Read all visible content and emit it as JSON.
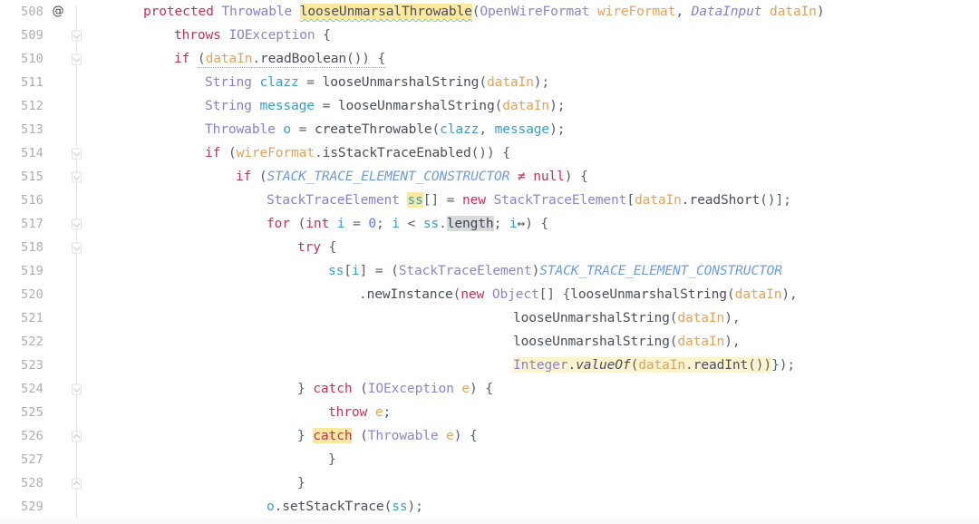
{
  "editor": {
    "language": "Java",
    "first_line": 508,
    "last_line": 529,
    "colors": {
      "background": "#ffffff",
      "line_number": "#adadad",
      "keyword": "#c0355b",
      "type": "#8a7fd0",
      "local_variable": "#3aa0c4",
      "parameter": "#e0a45e",
      "static_field": "#6f9ddb",
      "number": "#5a7fd0",
      "punctuation": "#56606e",
      "highlight_yellow": "#fbe9a0",
      "highlight_pale_yellow": "#fcf3cf",
      "highlight_gray": "#d8dadd",
      "typo_underline": "#7ec27e"
    },
    "gutter": {
      "annotation_marker": "@",
      "annotation_line": 508,
      "fold_open_lines": [
        509,
        510,
        514,
        515,
        517,
        518,
        524
      ],
      "fold_close_lines": [
        526,
        528
      ]
    },
    "lines": [
      {
        "number": "508",
        "indent": 1,
        "gutter_icon": "@",
        "fold": "none",
        "tokens": [
          {
            "text": "protected",
            "cls": "t-kw"
          },
          {
            "text": " ",
            "cls": "t-punc"
          },
          {
            "text": "Throwable",
            "cls": "t-type"
          },
          {
            "text": " ",
            "cls": "t-punc"
          },
          {
            "text": "looseUnmarsalThrowable",
            "cls": "t-method",
            "hl": "hl-yellow",
            "underline": "u-typo"
          },
          {
            "text": "(",
            "cls": "t-punc"
          },
          {
            "text": "OpenWireFormat",
            "cls": "t-cls"
          },
          {
            "text": " ",
            "cls": "t-punc"
          },
          {
            "text": "wireFormat",
            "cls": "t-param"
          },
          {
            "text": ", ",
            "cls": "t-punc"
          },
          {
            "text": "DataInput",
            "cls": "t-italic"
          },
          {
            "text": " ",
            "cls": "t-punc"
          },
          {
            "text": "dataIn",
            "cls": "t-param"
          },
          {
            "text": ")",
            "cls": "t-punc"
          }
        ]
      },
      {
        "number": "509",
        "indent": 2,
        "gutter_icon": "",
        "fold": "open",
        "tokens": [
          {
            "text": "throws",
            "cls": "t-kw"
          },
          {
            "text": " ",
            "cls": "t-punc"
          },
          {
            "text": "IOException",
            "cls": "t-cls"
          },
          {
            "text": " {",
            "cls": "t-punc"
          }
        ]
      },
      {
        "number": "510",
        "indent": 2,
        "gutter_icon": "",
        "fold": "open",
        "tokens": [
          {
            "text": "if",
            "cls": "t-kw"
          },
          {
            "text": " ",
            "cls": "t-punc"
          },
          {
            "text": "(",
            "cls": "t-punc",
            "underline": "u-dotted"
          },
          {
            "text": "dataIn",
            "cls": "t-param",
            "underline": "u-dotted"
          },
          {
            "text": ".",
            "cls": "t-punc",
            "underline": "u-dotted"
          },
          {
            "text": "readBoolean",
            "cls": "t-method",
            "underline": "u-dotted"
          },
          {
            "text": "()) {",
            "cls": "t-punc",
            "underline": "u-dotted"
          }
        ]
      },
      {
        "number": "511",
        "indent": 3,
        "gutter_icon": "",
        "fold": "none",
        "tokens": [
          {
            "text": "String",
            "cls": "t-type"
          },
          {
            "text": " ",
            "cls": "t-punc"
          },
          {
            "text": "clazz",
            "cls": "t-local"
          },
          {
            "text": " = ",
            "cls": "t-op"
          },
          {
            "text": "looseUnmarshalString",
            "cls": "t-method"
          },
          {
            "text": "(",
            "cls": "t-punc"
          },
          {
            "text": "dataIn",
            "cls": "t-param"
          },
          {
            "text": ");",
            "cls": "t-punc"
          }
        ]
      },
      {
        "number": "512",
        "indent": 3,
        "gutter_icon": "",
        "fold": "none",
        "tokens": [
          {
            "text": "String",
            "cls": "t-type"
          },
          {
            "text": " ",
            "cls": "t-punc"
          },
          {
            "text": "message",
            "cls": "t-local"
          },
          {
            "text": " = ",
            "cls": "t-op"
          },
          {
            "text": "looseUnmarshalString",
            "cls": "t-method"
          },
          {
            "text": "(",
            "cls": "t-punc"
          },
          {
            "text": "dataIn",
            "cls": "t-param"
          },
          {
            "text": ");",
            "cls": "t-punc"
          }
        ]
      },
      {
        "number": "513",
        "indent": 3,
        "gutter_icon": "",
        "fold": "none",
        "tokens": [
          {
            "text": "Throwable",
            "cls": "t-type"
          },
          {
            "text": " ",
            "cls": "t-punc"
          },
          {
            "text": "o",
            "cls": "t-local"
          },
          {
            "text": " = ",
            "cls": "t-op"
          },
          {
            "text": "createThrowable",
            "cls": "t-method"
          },
          {
            "text": "(",
            "cls": "t-punc"
          },
          {
            "text": "clazz",
            "cls": "t-local"
          },
          {
            "text": ", ",
            "cls": "t-punc"
          },
          {
            "text": "message",
            "cls": "t-local"
          },
          {
            "text": ");",
            "cls": "t-punc"
          }
        ]
      },
      {
        "number": "514",
        "indent": 3,
        "gutter_icon": "",
        "fold": "open",
        "tokens": [
          {
            "text": "if",
            "cls": "t-kw"
          },
          {
            "text": " (",
            "cls": "t-punc"
          },
          {
            "text": "wireFormat",
            "cls": "t-param"
          },
          {
            "text": ".",
            "cls": "t-punc"
          },
          {
            "text": "isStackTraceEnabled",
            "cls": "t-method"
          },
          {
            "text": "()) {",
            "cls": "t-punc"
          }
        ]
      },
      {
        "number": "515",
        "indent": 4,
        "gutter_icon": "",
        "fold": "open",
        "tokens": [
          {
            "text": "if",
            "cls": "t-kw"
          },
          {
            "text": " (",
            "cls": "t-punc"
          },
          {
            "text": "STACK_TRACE_ELEMENT_CONSTRUCTOR",
            "cls": "t-static"
          },
          {
            "text": " ",
            "cls": "t-punc"
          },
          {
            "text": "≠",
            "cls": "t-kw"
          },
          {
            "text": " ",
            "cls": "t-punc"
          },
          {
            "text": "null",
            "cls": "t-kw"
          },
          {
            "text": ") {",
            "cls": "t-punc"
          }
        ]
      },
      {
        "number": "516",
        "indent": 5,
        "gutter_icon": "",
        "fold": "none",
        "tokens": [
          {
            "text": "StackTraceElement",
            "cls": "t-type"
          },
          {
            "text": " ",
            "cls": "t-punc"
          },
          {
            "text": "ss",
            "cls": "t-local",
            "hl": "hl-yellow"
          },
          {
            "text": "[] = ",
            "cls": "t-punc"
          },
          {
            "text": "new",
            "cls": "t-kw"
          },
          {
            "text": " ",
            "cls": "t-punc"
          },
          {
            "text": "StackTraceElement",
            "cls": "t-cls"
          },
          {
            "text": "[",
            "cls": "t-punc"
          },
          {
            "text": "dataIn",
            "cls": "t-param"
          },
          {
            "text": ".",
            "cls": "t-punc"
          },
          {
            "text": "readShort",
            "cls": "t-method"
          },
          {
            "text": "()];",
            "cls": "t-punc"
          }
        ]
      },
      {
        "number": "517",
        "indent": 5,
        "gutter_icon": "",
        "fold": "open",
        "tokens": [
          {
            "text": "for",
            "cls": "t-kw"
          },
          {
            "text": " (",
            "cls": "t-punc"
          },
          {
            "text": "int",
            "cls": "t-kw"
          },
          {
            "text": " ",
            "cls": "t-punc"
          },
          {
            "text": "i",
            "cls": "t-local"
          },
          {
            "text": " = ",
            "cls": "t-op"
          },
          {
            "text": "0",
            "cls": "t-num"
          },
          {
            "text": "; ",
            "cls": "t-punc"
          },
          {
            "text": "i",
            "cls": "t-local"
          },
          {
            "text": " < ",
            "cls": "t-op"
          },
          {
            "text": "ss",
            "cls": "t-local"
          },
          {
            "text": ".",
            "cls": "t-punc"
          },
          {
            "text": "length",
            "cls": "t-field",
            "hl": "hl-gray"
          },
          {
            "text": "; ",
            "cls": "t-punc"
          },
          {
            "text": "i",
            "cls": "t-local"
          },
          {
            "text": "↔",
            "cls": "t-op"
          },
          {
            "text": ") {",
            "cls": "t-punc"
          }
        ]
      },
      {
        "number": "518",
        "indent": 6,
        "gutter_icon": "",
        "fold": "open",
        "tokens": [
          {
            "text": "try",
            "cls": "t-kw"
          },
          {
            "text": " {",
            "cls": "t-punc"
          }
        ]
      },
      {
        "number": "519",
        "indent": 7,
        "gutter_icon": "",
        "fold": "none",
        "tokens": [
          {
            "text": "ss",
            "cls": "t-local"
          },
          {
            "text": "[",
            "cls": "t-punc"
          },
          {
            "text": "i",
            "cls": "t-local"
          },
          {
            "text": "] = (",
            "cls": "t-punc"
          },
          {
            "text": "StackTraceElement",
            "cls": "t-cls"
          },
          {
            "text": ")",
            "cls": "t-punc"
          },
          {
            "text": "STACK_TRACE_ELEMENT_CONSTRUCTOR",
            "cls": "t-static"
          }
        ]
      },
      {
        "number": "520",
        "indent": 8,
        "gutter_icon": "",
        "fold": "none",
        "tokens": [
          {
            "text": ".",
            "cls": "t-punc"
          },
          {
            "text": "newInstance",
            "cls": "t-method"
          },
          {
            "text": "(",
            "cls": "t-punc"
          },
          {
            "text": "new",
            "cls": "t-kw"
          },
          {
            "text": " ",
            "cls": "t-punc"
          },
          {
            "text": "Object",
            "cls": "t-cls"
          },
          {
            "text": "[] {",
            "cls": "t-punc"
          },
          {
            "text": "looseUnmarshalString",
            "cls": "t-method"
          },
          {
            "text": "(",
            "cls": "t-punc"
          },
          {
            "text": "dataIn",
            "cls": "t-param"
          },
          {
            "text": "),",
            "cls": "t-punc"
          }
        ]
      },
      {
        "number": "521",
        "indent": 13,
        "gutter_icon": "",
        "fold": "none",
        "tokens": [
          {
            "text": "looseUnmarshalString",
            "cls": "t-method"
          },
          {
            "text": "(",
            "cls": "t-punc"
          },
          {
            "text": "dataIn",
            "cls": "t-param"
          },
          {
            "text": "),",
            "cls": "t-punc"
          }
        ]
      },
      {
        "number": "522",
        "indent": 13,
        "gutter_icon": "",
        "fold": "none",
        "tokens": [
          {
            "text": "looseUnmarshalString",
            "cls": "t-method"
          },
          {
            "text": "(",
            "cls": "t-punc"
          },
          {
            "text": "dataIn",
            "cls": "t-param"
          },
          {
            "text": "),",
            "cls": "t-punc"
          }
        ]
      },
      {
        "number": "523",
        "indent": 13,
        "gutter_icon": "",
        "fold": "none",
        "tokens": [
          {
            "text": "Integer",
            "cls": "t-cls",
            "hl": "hl-paleyellow"
          },
          {
            "text": ".",
            "cls": "t-punc",
            "hl": "hl-paleyellow"
          },
          {
            "text": "valueOf",
            "cls": "t-staticm",
            "hl": "hl-paleyellow"
          },
          {
            "text": "(",
            "cls": "t-punc",
            "hl": "hl-paleyellow"
          },
          {
            "text": "dataIn",
            "cls": "t-param",
            "hl": "hl-paleyellow"
          },
          {
            "text": ".",
            "cls": "t-punc",
            "hl": "hl-paleyellow"
          },
          {
            "text": "readInt",
            "cls": "t-method",
            "hl": "hl-paleyellow"
          },
          {
            "text": "())",
            "cls": "t-punc",
            "hl": "hl-paleyellow"
          },
          {
            "text": "});",
            "cls": "t-punc"
          }
        ]
      },
      {
        "number": "524",
        "indent": 6,
        "gutter_icon": "",
        "fold": "open",
        "tokens": [
          {
            "text": "} ",
            "cls": "t-punc"
          },
          {
            "text": "catch",
            "cls": "t-kw"
          },
          {
            "text": " (",
            "cls": "t-punc"
          },
          {
            "text": "IOException",
            "cls": "t-cls"
          },
          {
            "text": " ",
            "cls": "t-punc"
          },
          {
            "text": "e",
            "cls": "t-param"
          },
          {
            "text": ") {",
            "cls": "t-punc"
          }
        ]
      },
      {
        "number": "525",
        "indent": 7,
        "gutter_icon": "",
        "fold": "none",
        "tokens": [
          {
            "text": "throw",
            "cls": "t-kw"
          },
          {
            "text": " ",
            "cls": "t-punc"
          },
          {
            "text": "e",
            "cls": "t-param"
          },
          {
            "text": ";",
            "cls": "t-punc"
          }
        ]
      },
      {
        "number": "526",
        "indent": 6,
        "gutter_icon": "",
        "fold": "close",
        "tokens": [
          {
            "text": "} ",
            "cls": "t-punc"
          },
          {
            "text": "catch",
            "cls": "t-kw",
            "hl": "hl-yellow"
          },
          {
            "text": " (",
            "cls": "t-punc"
          },
          {
            "text": "Throwable",
            "cls": "t-cls"
          },
          {
            "text": " ",
            "cls": "t-punc"
          },
          {
            "text": "e",
            "cls": "t-param"
          },
          {
            "text": ") {",
            "cls": "t-punc"
          }
        ]
      },
      {
        "number": "527",
        "indent": 7,
        "gutter_icon": "",
        "fold": "none",
        "tokens": [
          {
            "text": "}",
            "cls": "t-punc"
          }
        ]
      },
      {
        "number": "528",
        "indent": 6,
        "gutter_icon": "",
        "fold": "close",
        "tokens": [
          {
            "text": "}",
            "cls": "t-punc"
          }
        ]
      },
      {
        "number": "529",
        "indent": 5,
        "gutter_icon": "",
        "fold": "none",
        "tokens": [
          {
            "text": "o",
            "cls": "t-local"
          },
          {
            "text": ".",
            "cls": "t-punc"
          },
          {
            "text": "setStackTrace",
            "cls": "t-method"
          },
          {
            "text": "(",
            "cls": "t-punc"
          },
          {
            "text": "ss",
            "cls": "t-local"
          },
          {
            "text": ");",
            "cls": "t-punc"
          }
        ]
      }
    ]
  }
}
